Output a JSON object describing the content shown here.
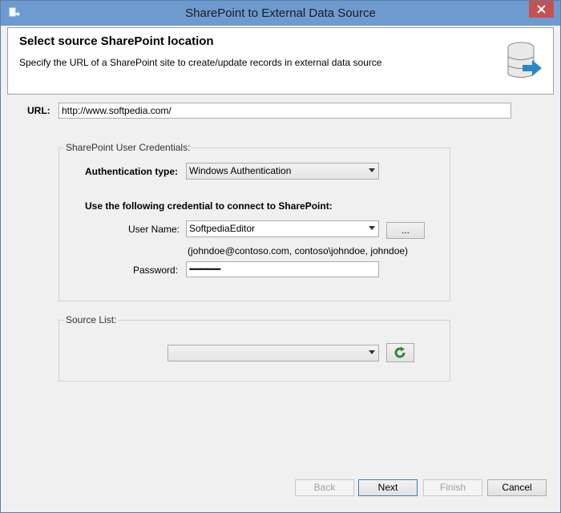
{
  "window": {
    "title": "SharePoint to External Data Source"
  },
  "header": {
    "title": "Select source SharePoint location",
    "description": "Specify the URL of a SharePoint site to create/update records in external data source"
  },
  "url": {
    "label": "URL:",
    "value": "http://www.softpedia.com/"
  },
  "credentials": {
    "legend": "SharePoint User Credentials:",
    "auth_type_label": "Authentication type:",
    "auth_type_value": "Windows Authentication",
    "use_credential_label": "Use the following credential to connect to SharePoint:",
    "username_label": "User Name:",
    "username_value": "SoftpediaEditor",
    "browse_label": "...",
    "username_hint": "(johndoe@contoso.com, contoso\\johndoe, johndoe)",
    "password_label": "Password:",
    "password_value": "••••••••••••••••••"
  },
  "source_list": {
    "legend": "Source List:",
    "value": ""
  },
  "footer": {
    "back": "Back",
    "next": "Next",
    "finish": "Finish",
    "cancel": "Cancel"
  },
  "colors": {
    "titlebar": "#6e9bcf",
    "close": "#c75050",
    "refresh_green": "#2e8b2e"
  }
}
